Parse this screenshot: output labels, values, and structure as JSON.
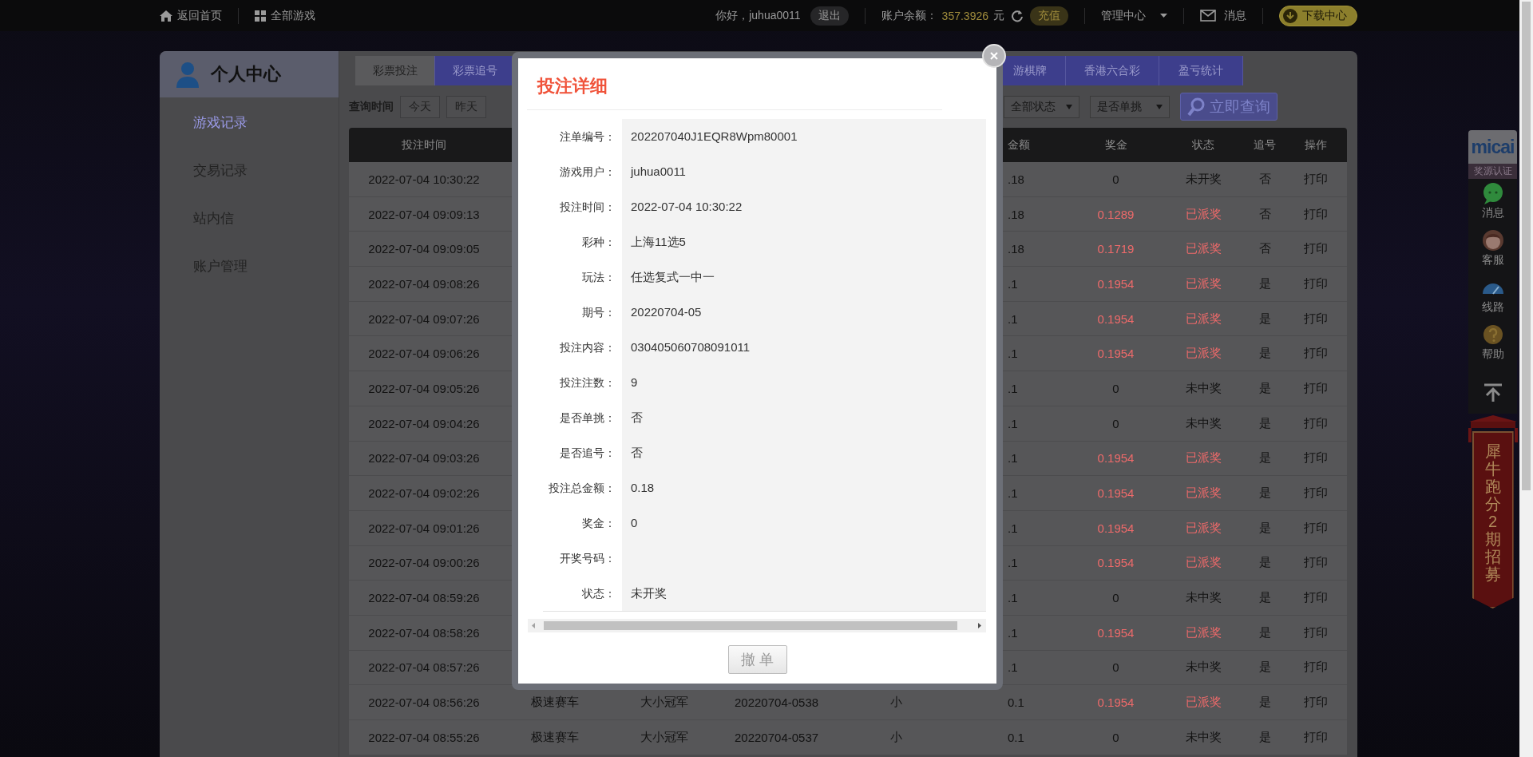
{
  "top_bar": {
    "home": "返回首页",
    "all_games": "全部游戏",
    "greeting": "你好，juhua0011",
    "logout": "退出",
    "balance_label": "账户余额：",
    "balance": "357.3926",
    "currency": "元",
    "recharge": "充值",
    "manage": "管理中心",
    "messages": "消息",
    "download": "下载中心"
  },
  "sidebar": {
    "title": "个人中心",
    "items": [
      {
        "label": "游戏记录",
        "selected": true
      },
      {
        "label": "交易记录",
        "selected": false
      },
      {
        "label": "站内信",
        "selected": false
      },
      {
        "label": "账户管理",
        "selected": false
      }
    ]
  },
  "tabs": [
    {
      "label": "彩票投注",
      "selected": true
    },
    {
      "label": "彩票追号",
      "selected": false
    },
    {
      "label": "游棋牌",
      "selected": false
    },
    {
      "label": "香港六合彩",
      "selected": false
    },
    {
      "label": "盈亏统计",
      "selected": false
    }
  ],
  "filters": {
    "label": "查询时间",
    "quick_ranges": [
      "今天",
      "昨天"
    ],
    "status_select": "全部状态",
    "single_select": "是否单挑",
    "query_button": "立即查询"
  },
  "table": {
    "columns": {
      "time": "投注时间",
      "amount": "金额",
      "prize": "奖金",
      "status": "状态",
      "chase": "追号",
      "action": "操作"
    },
    "rows": [
      {
        "time": "2022-07-04 10:30:22",
        "amount": ".18",
        "prize": "0",
        "status": "未开奖",
        "chase": "否",
        "action": "打印",
        "won": false
      },
      {
        "time": "2022-07-04 09:09:13",
        "amount": ".18",
        "prize": "0.1289",
        "status": "已派奖",
        "chase": "否",
        "action": "打印",
        "won": true
      },
      {
        "time": "2022-07-04 09:09:05",
        "amount": ".18",
        "prize": "0.1719",
        "status": "已派奖",
        "chase": "否",
        "action": "打印",
        "won": true
      },
      {
        "time": "2022-07-04 09:08:26",
        "amount": ".1",
        "prize": "0.1954",
        "status": "已派奖",
        "chase": "是",
        "action": "打印",
        "won": true
      },
      {
        "time": "2022-07-04 09:07:26",
        "amount": ".1",
        "prize": "0.1954",
        "status": "已派奖",
        "chase": "是",
        "action": "打印",
        "won": true
      },
      {
        "time": "2022-07-04 09:06:26",
        "amount": ".1",
        "prize": "0.1954",
        "status": "已派奖",
        "chase": "是",
        "action": "打印",
        "won": true
      },
      {
        "time": "2022-07-04 09:05:26",
        "amount": ".1",
        "prize": "0",
        "status": "未中奖",
        "chase": "是",
        "action": "打印",
        "won": false
      },
      {
        "time": "2022-07-04 09:04:26",
        "amount": ".1",
        "prize": "0",
        "status": "未中奖",
        "chase": "是",
        "action": "打印",
        "won": false
      },
      {
        "time": "2022-07-04 09:03:26",
        "amount": ".1",
        "prize": "0.1954",
        "status": "已派奖",
        "chase": "是",
        "action": "打印",
        "won": true
      },
      {
        "time": "2022-07-04 09:02:26",
        "amount": ".1",
        "prize": "0.1954",
        "status": "已派奖",
        "chase": "是",
        "action": "打印",
        "won": true
      },
      {
        "time": "2022-07-04 09:01:26",
        "amount": ".1",
        "prize": "0.1954",
        "status": "已派奖",
        "chase": "是",
        "action": "打印",
        "won": true
      },
      {
        "time": "2022-07-04 09:00:26",
        "amount": ".1",
        "prize": "0.1954",
        "status": "已派奖",
        "chase": "是",
        "action": "打印",
        "won": true
      },
      {
        "time": "2022-07-04 08:59:26",
        "amount": ".1",
        "prize": "0",
        "status": "未中奖",
        "chase": "是",
        "action": "打印",
        "won": false
      },
      {
        "time": "2022-07-04 08:58:26",
        "amount": ".1",
        "prize": "0.1954",
        "status": "已派奖",
        "chase": "是",
        "action": "打印",
        "won": true
      },
      {
        "time": "2022-07-04 08:57:26",
        "amount": ".1",
        "prize": "0",
        "status": "未中奖",
        "chase": "是",
        "action": "打印",
        "won": false
      },
      {
        "time": "2022-07-04 08:56:26",
        "lottery": "极速赛车",
        "play": "大小冠军",
        "issue": "20220704-0538",
        "content": "小",
        "amount": "0.1",
        "prize": "0.1954",
        "status": "已派奖",
        "chase": "是",
        "action": "打印",
        "won": true
      },
      {
        "time": "2022-07-04 08:55:26",
        "lottery": "极速赛车",
        "play": "大小冠军",
        "issue": "20220704-0537",
        "content": "小",
        "amount": "0.1",
        "prize": "0",
        "status": "未中奖",
        "chase": "是",
        "action": "打印",
        "won": false
      }
    ]
  },
  "detail_dialog": {
    "title": "投注详细",
    "fields": [
      {
        "label": "注单编号：",
        "value": "202207040J1EQR8Wpm80001"
      },
      {
        "label": "游戏用户：",
        "value": "juhua0011"
      },
      {
        "label": "投注时间：",
        "value": "2022-07-04 10:30:22"
      },
      {
        "label": "彩种：",
        "value": "上海11选5"
      },
      {
        "label": "玩法：",
        "value": "任选复式一中一"
      },
      {
        "label": "期号：",
        "value": "20220704-05"
      },
      {
        "label": "投注内容：",
        "value": "030405060708091011"
      },
      {
        "label": "投注注数：",
        "value": "9"
      },
      {
        "label": "是否单挑：",
        "value": "否"
      },
      {
        "label": "是否追号：",
        "value": "否"
      },
      {
        "label": "投注总金额：",
        "value": "0.18"
      },
      {
        "label": "奖金：",
        "value": "0"
      },
      {
        "label": "开奖号码："
      },
      {
        "label": "状态：",
        "value": "未开奖"
      }
    ],
    "cancel_button": "撤单"
  },
  "float_bar": {
    "logo": "micai",
    "certification": "奖源认证",
    "items": [
      {
        "kind": "chat",
        "label": "消息"
      },
      {
        "kind": "service",
        "label": "客服"
      },
      {
        "kind": "route",
        "label": "线路"
      },
      {
        "kind": "help",
        "label": "帮助"
      }
    ],
    "banner": "犀牛跑分2期招募"
  }
}
